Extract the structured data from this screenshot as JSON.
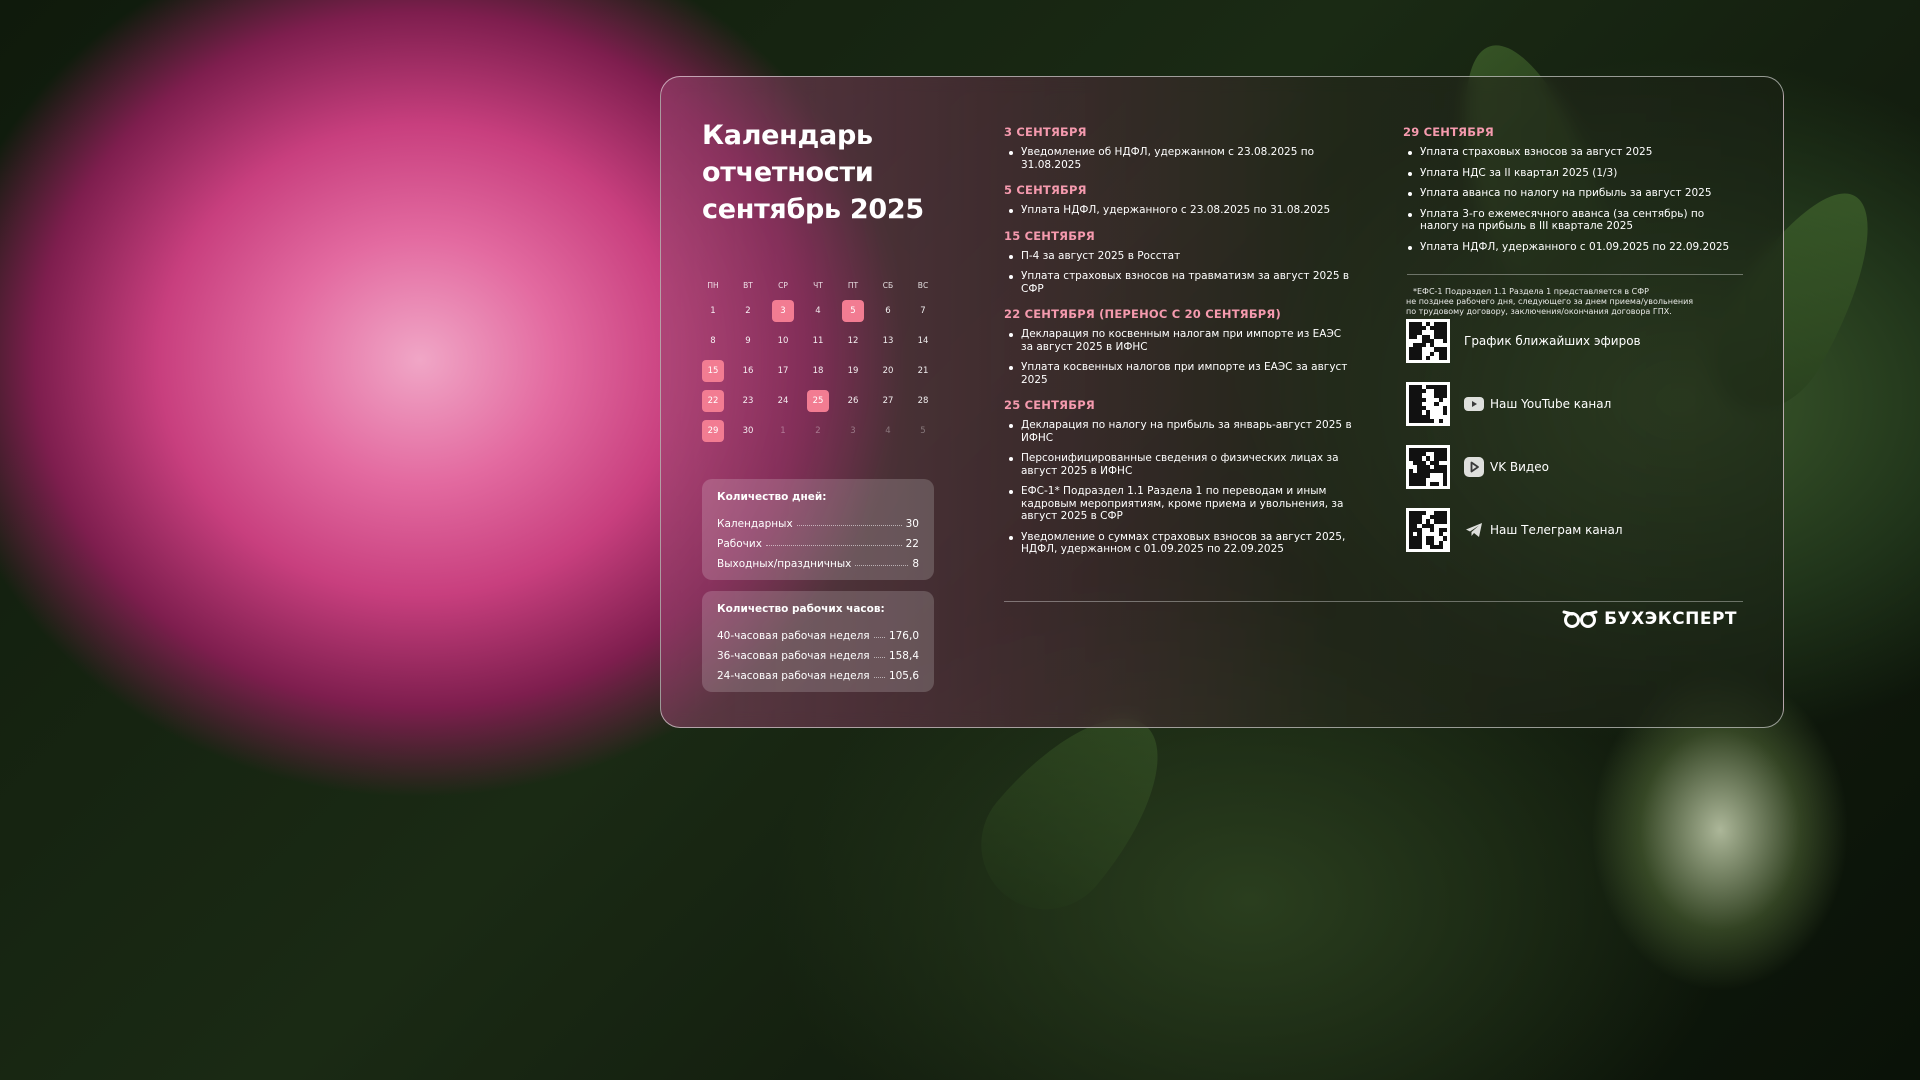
{
  "title": [
    "Календарь",
    "отчетности",
    "сентябрь 2025"
  ],
  "calendar": {
    "weekdays": [
      "ПН",
      "ВТ",
      "СР",
      "ЧТ",
      "ПТ",
      "СБ",
      "ВС"
    ],
    "weeks": [
      [
        {
          "d": "1"
        },
        {
          "d": "2"
        },
        {
          "d": "3",
          "hl": true
        },
        {
          "d": "4"
        },
        {
          "d": "5",
          "hl": true
        },
        {
          "d": "6"
        },
        {
          "d": "7"
        }
      ],
      [
        {
          "d": "8"
        },
        {
          "d": "9"
        },
        {
          "d": "10"
        },
        {
          "d": "11"
        },
        {
          "d": "12"
        },
        {
          "d": "13"
        },
        {
          "d": "14"
        }
      ],
      [
        {
          "d": "15",
          "hl": true
        },
        {
          "d": "16"
        },
        {
          "d": "17"
        },
        {
          "d": "18"
        },
        {
          "d": "19"
        },
        {
          "d": "20"
        },
        {
          "d": "21"
        }
      ],
      [
        {
          "d": "22",
          "hl": true
        },
        {
          "d": "23"
        },
        {
          "d": "24"
        },
        {
          "d": "25",
          "hl": true
        },
        {
          "d": "26"
        },
        {
          "d": "27"
        },
        {
          "d": "28"
        }
      ],
      [
        {
          "d": "29",
          "hl": true
        },
        {
          "d": "30"
        },
        {
          "d": "1",
          "dim": true
        },
        {
          "d": "2",
          "dim": true
        },
        {
          "d": "3",
          "dim": true
        },
        {
          "d": "4",
          "dim": true
        },
        {
          "d": "5",
          "dim": true
        }
      ]
    ]
  },
  "days_panel": {
    "title": "Количество дней:",
    "rows": [
      {
        "label": "Календарных",
        "value": "30"
      },
      {
        "label": "Рабочих",
        "value": "22"
      },
      {
        "label": "Выходных/праздничных",
        "value": "8"
      }
    ]
  },
  "hours_panel": {
    "title": "Количество рабочих часов:",
    "rows": [
      {
        "label": "40-часовая рабочая неделя",
        "value": "176,0"
      },
      {
        "label": "36-часовая рабочая неделя",
        "value": "158,4"
      },
      {
        "label": "24-часовая рабочая неделя",
        "value": "105,6"
      }
    ]
  },
  "sections_mid": [
    {
      "title": "3 СЕНТЯБРЯ",
      "items": [
        "Уведомление об НДФЛ, удержанном с 23.08.2025 по 31.08.2025"
      ]
    },
    {
      "title": "5 СЕНТЯБРЯ",
      "items": [
        "Уплата НДФЛ, удержанного с 23.08.2025 по 31.08.2025"
      ]
    },
    {
      "title": "15 СЕНТЯБРЯ",
      "items": [
        "П-4 за август 2025 в Росстат",
        "Уплата страховых взносов на травматизм за август 2025 в СФР"
      ]
    },
    {
      "title": "22 СЕНТЯБРЯ (ПЕРЕНОС С 20 СЕНТЯБРЯ)",
      "items": [
        "Декларация по косвенным налогам при импорте из ЕАЭС за август 2025 в ИФНС",
        "Уплата косвенных налогов при импорте из ЕАЭС за август 2025"
      ]
    },
    {
      "title": "25 СЕНТЯБРЯ",
      "items": [
        "Декларация по налогу на прибыль за январь-август 2025 в ИФНС",
        "Персонифицированные сведения о физических лицах за август 2025 в ИФНС",
        "ЕФС-1* Подраздел 1.1 Раздела 1 по переводам и иным кадровым мероприятиям, кроме приема и увольнения, за август 2025 в СФР",
        "Уведомление о суммах страховых взносов за август 2025, НДФЛ, удержанном с 01.09.2025 по 22.09.2025"
      ]
    }
  ],
  "sections_right": [
    {
      "title": "29 СЕНТЯБРЯ",
      "items": [
        "Уплата страховых взносов за август 2025",
        "Уплата НДС за II квартал 2025 (1/3)",
        "Уплата аванса по налогу на прибыль за август 2025",
        "Уплата 3-го ежемесячного аванса (за сентябрь) по налогу на прибыль в III квартале 2025",
        "Уплата НДФЛ, удержанного с 01.09.2025 по 22.09.2025"
      ]
    }
  ],
  "note": [
    "*ЕФС-1 Подраздел 1.1 Раздела 1 представляется в СФР",
    "не позднее рабочего дня, следующего за днем приема/увольнения",
    "по трудовому договору, заключения/окончания договора ГПХ."
  ],
  "links": [
    {
      "label": "График ближайших эфиров",
      "icon": "none"
    },
    {
      "label": "Наш YouTube канал",
      "icon": "youtube-icon"
    },
    {
      "label": "VK Видео",
      "icon": "vk-video-icon"
    },
    {
      "label": "Наш Телеграм канал",
      "icon": "telegram-icon"
    }
  ],
  "brand": "БУХЭКСПЕРТ",
  "colors": {
    "accent": "#f59aae",
    "highlight": "#f27c92"
  }
}
